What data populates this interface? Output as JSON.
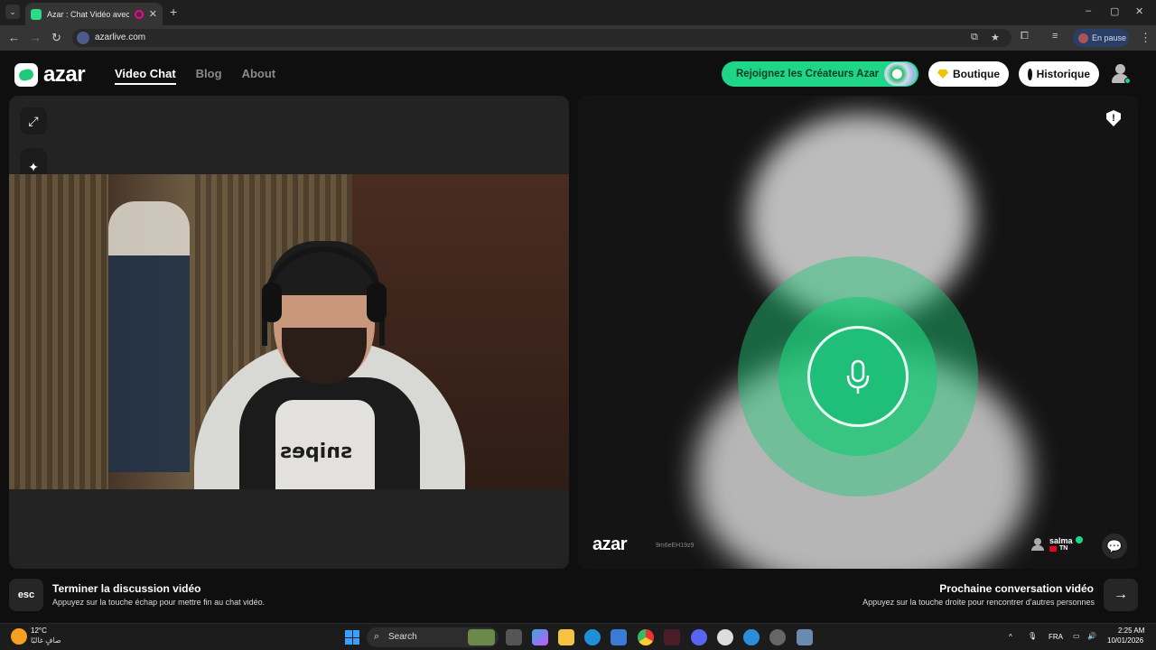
{
  "browser": {
    "tab_title": "Azar : Chat Vidéo avec de n",
    "tab_close": "✕",
    "new_tab": "+",
    "url": "azarlive.com",
    "profile_status": "En pause",
    "window_controls": [
      "–",
      "▢",
      "✕"
    ]
  },
  "site": {
    "logo_text": "azar",
    "nav": [
      {
        "label": "Video Chat",
        "active": true
      },
      {
        "label": "Blog",
        "active": false
      },
      {
        "label": "About",
        "active": false
      }
    ],
    "creators_button": "Rejoignez les Créateurs Azar",
    "shop_button": "Boutique",
    "history_button": "Historique",
    "accent_color": "#1fd588"
  },
  "right_panel": {
    "logo_text": "azar",
    "session_id": "9m6eEH19z9",
    "peer_name": "salma",
    "peer_country": "TN",
    "shield_symbol": "!"
  },
  "left_panel": {
    "shirt_text": "snipes"
  },
  "hints": {
    "esc_key": "esc",
    "end_title": "Terminer la discussion vidéo",
    "end_sub": "Appuyez sur la touche échap pour mettre fin au chat vidéo.",
    "next_title": "Prochaine conversation vidéo",
    "next_sub": "Appuyez sur la touche droite pour rencontrer d'autres personnes",
    "next_key": "→"
  },
  "taskbar": {
    "temperature": "12°C",
    "weather_desc": "صافٍ غالبًا",
    "search_label": "Search",
    "language": "FRA",
    "time": "2:25 AM",
    "date": "10/01/2026"
  }
}
